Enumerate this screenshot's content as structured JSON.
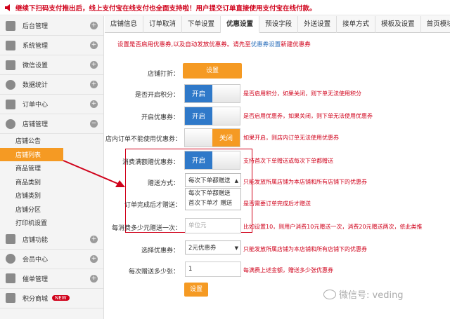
{
  "notice": "继续下扫码支付推出后，线上支付宝在线支付也全面支持啦！用户提交订单直接使用支付宝在线付款。",
  "sidebar": {
    "items": [
      {
        "label": "后台管理",
        "icon": "home-icon"
      },
      {
        "label": "系统管理",
        "icon": "system-icon"
      },
      {
        "label": "微信设置",
        "icon": "wechat-icon"
      },
      {
        "label": "数据统计",
        "icon": "stats-icon"
      },
      {
        "label": "订单中心",
        "icon": "order-icon"
      },
      {
        "label": "店铺管理",
        "icon": "shop-icon"
      }
    ],
    "sub_items": [
      "店铺公告",
      "店铺列表",
      "商品管理",
      "商品类别",
      "店铺类别",
      "店铺分区",
      "打印机设置"
    ],
    "bottom_items": [
      {
        "label": "店铺功能",
        "icon": "plus-icon"
      },
      {
        "label": "会员中心",
        "icon": "member-icon"
      },
      {
        "label": "催单管理",
        "icon": "remind-icon"
      },
      {
        "label": "积分商城",
        "icon": "points-icon",
        "badge": "NEW"
      }
    ]
  },
  "tabs": [
    "店铺信息",
    "订单取消",
    "下单设置",
    "优惠设置",
    "预设字段",
    "外送设置",
    "接单方式",
    "模板及设置",
    "首页模块"
  ],
  "tip": {
    "text1": "设置是否启用优惠券,以及自动发放优惠券。请先至",
    "link": "优惠券设置",
    "text2": "新建优惠券"
  },
  "form": {
    "discount_label": "店铺打折：",
    "discount_button": "设置",
    "points_label": "是否开启积分：",
    "points_toggle": "开启",
    "points_note": "是否启用积分，如果关闭，则下单无法使用积分",
    "coupon_label": "开启优惠券：",
    "coupon_toggle": "开启",
    "coupon_note": "是否启用优惠券，如果关闭，则下单无法使用优惠券",
    "instore_label": "店内订单不能使用优惠券：",
    "instore_toggle": "关闭",
    "instore_note": "如果开启，则店内订单无法使用优惠券",
    "full_gift_label": "消费满额赠优惠券：",
    "full_gift_toggle": "开启",
    "full_gift_note": "支持首次下单赠送或每次下单都赠送",
    "gift_method_label": "赠送方式：",
    "gift_method_value": "每次下单都赠送",
    "gift_method_options": [
      "每次下单都赠送",
      "首次下单才 赠送"
    ],
    "gift_method_note": "只能发放所属店铺为本店铺和所有店铺下的优惠券",
    "complete_label": "订单完成后才赠送：",
    "complete_note": "是否需要订单完成后才赠送",
    "per_amount_label": "每消费多少元赠送一次：",
    "per_amount_placeholder": "单位元",
    "per_amount_note": "比如设置10，则用户消费10元赠送一次，消费20元赠送两次，依此类推",
    "select_coupon_label": "选择优惠券：",
    "select_coupon_value": "2元优惠券",
    "select_coupon_note": "只能发放所属店铺为本店铺和所有店铺下的优惠券",
    "per_count_label": "每次赠送多少张：",
    "per_count_value": "1",
    "per_count_note": "每满费上述金额，赠送多少张优惠券",
    "submit_button": "设置"
  },
  "watermark": "微信号: veding"
}
